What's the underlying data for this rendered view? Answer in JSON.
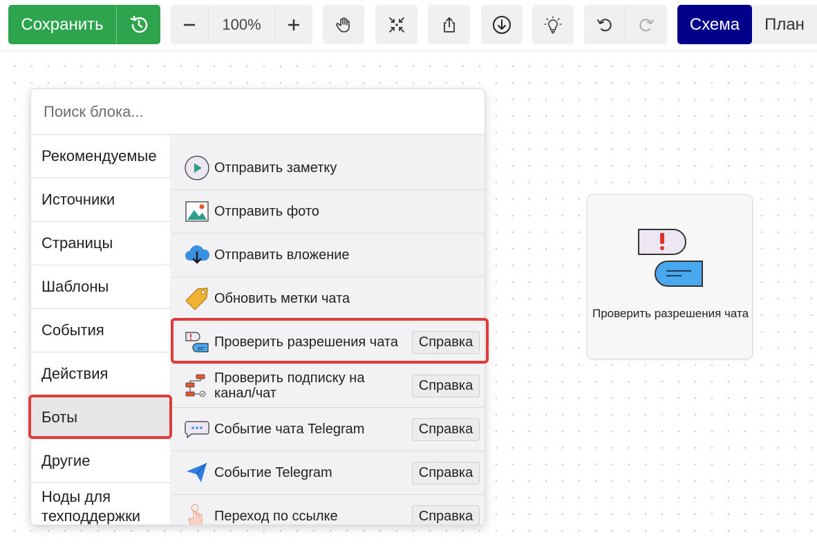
{
  "toolbar": {
    "save_label": "Сохранить",
    "zoom_value": "100%",
    "view_schema_label": "Схема",
    "view_plan_label": "План",
    "icons": [
      "history-icon",
      "minus-icon",
      "plus-icon",
      "hand-icon",
      "fit-icon",
      "share-icon",
      "download-icon",
      "bulb-icon",
      "undo-icon",
      "redo-icon"
    ]
  },
  "picker": {
    "search_placeholder": "Поиск блока...",
    "categories": [
      "Рекомендуемые",
      "Источники",
      "Страницы",
      "Шаблоны",
      "События",
      "Действия",
      "Боты",
      "Другие",
      "Ноды для техподдержки"
    ],
    "active_category": "Боты",
    "blocks": [
      {
        "label": "Отправить заметку",
        "icon": "play-icon",
        "help": ""
      },
      {
        "label": "Отправить фото",
        "icon": "photo-icon",
        "help": ""
      },
      {
        "label": "Отправить вложение",
        "icon": "cloud-download-icon",
        "help": ""
      },
      {
        "label": "Обновить метки чата",
        "icon": "tag-icon",
        "help": ""
      },
      {
        "label": "Проверить разрешения чата",
        "icon": "chat-permissions-icon",
        "help": "Справка"
      },
      {
        "label": "Проверить подписку на канал/чат",
        "icon": "flow-check-icon",
        "help": "Справка"
      },
      {
        "label": "Событие чата Telegram",
        "icon": "chat-bubble-icon",
        "help": "Справка"
      },
      {
        "label": "Событие Telegram",
        "icon": "telegram-icon",
        "help": "Справка"
      },
      {
        "label": "Переход по ссылке",
        "icon": "pointer-hand-icon",
        "help": "Справка"
      }
    ]
  },
  "node": {
    "label": "Проверить разрешения чата",
    "icon": "chat-permissions-icon"
  },
  "colors": {
    "save_green": "#2ea44f",
    "schema_active": "#00008b",
    "highlight_red": "#e03b3b"
  }
}
